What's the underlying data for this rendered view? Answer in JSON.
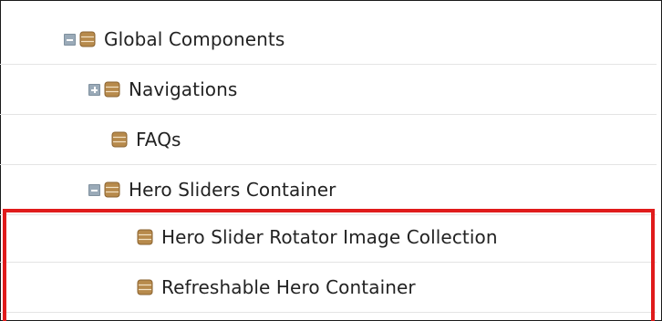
{
  "tree": {
    "items": [
      {
        "label": "Global Components",
        "expanded": true,
        "toggle": "minus-icon",
        "icon": "database-icon"
      },
      {
        "label": "Navigations",
        "expanded": false,
        "toggle": "plus-icon",
        "icon": "database-icon"
      },
      {
        "label": "FAQs",
        "icon": "database-icon"
      },
      {
        "label": "Hero Sliders Container",
        "expanded": true,
        "toggle": "minus-icon",
        "icon": "database-icon"
      },
      {
        "label": "Hero Slider Rotator Image Collection",
        "icon": "database-icon"
      },
      {
        "label": "Refreshable Hero Container",
        "icon": "database-icon"
      }
    ]
  },
  "colors": {
    "highlight_border": "#e01b1b",
    "icon_fill": "#b78a4c",
    "toggle_fill": "#9aaab8"
  }
}
